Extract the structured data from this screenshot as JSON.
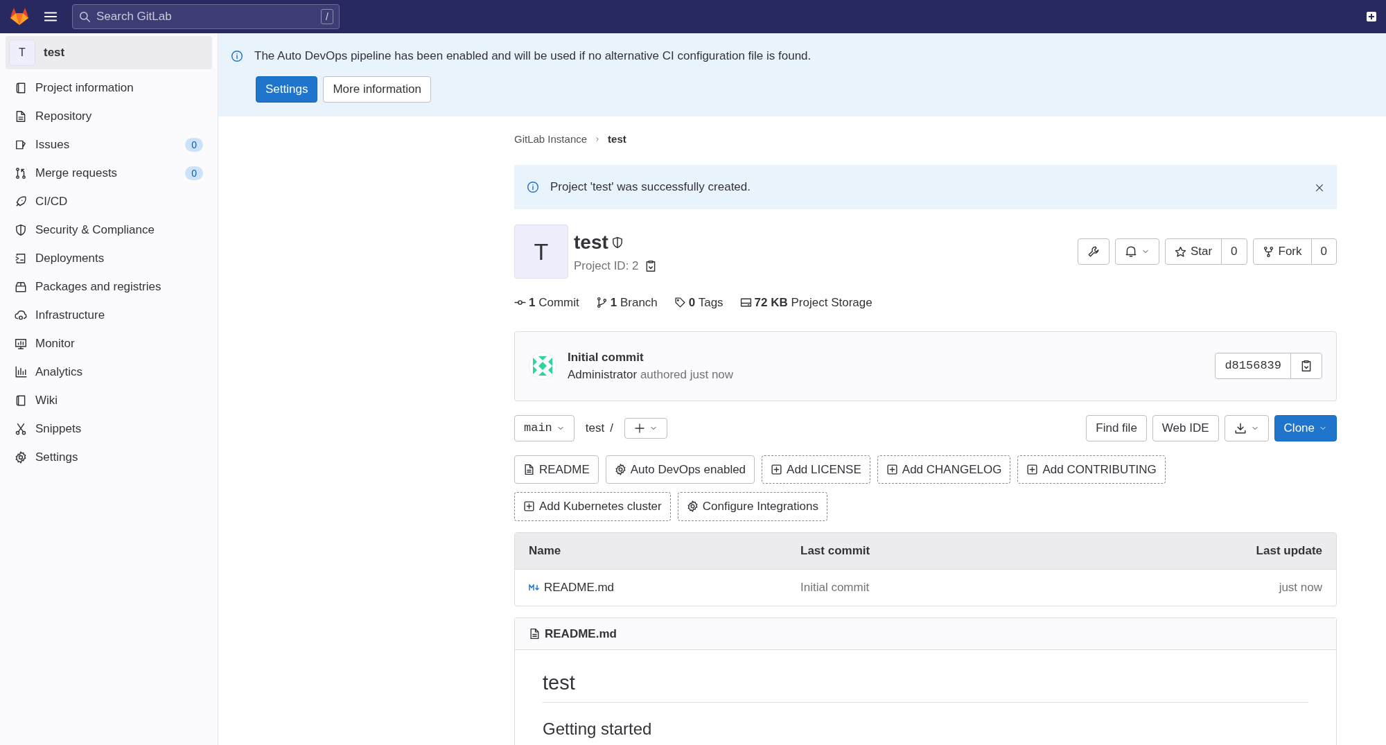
{
  "topbar": {
    "search": {
      "placeholder": "Search GitLab",
      "shortcut": "/"
    }
  },
  "sidebar": {
    "project": {
      "avatar": "T",
      "name": "test",
      "selected": true
    },
    "items": [
      {
        "label": "Project information"
      },
      {
        "label": "Repository"
      },
      {
        "label": "Issues",
        "count": "0"
      },
      {
        "label": "Merge requests",
        "count": "0"
      },
      {
        "label": "CI/CD"
      },
      {
        "label": "Security & Compliance"
      },
      {
        "label": "Deployments"
      },
      {
        "label": "Packages and registries"
      },
      {
        "label": "Infrastructure"
      },
      {
        "label": "Monitor"
      },
      {
        "label": "Analytics"
      },
      {
        "label": "Wiki"
      },
      {
        "label": "Snippets"
      },
      {
        "label": "Settings"
      }
    ]
  },
  "banner": {
    "text": "The Auto DevOps pipeline has been enabled and will be used if no alternative CI configuration file is found.",
    "buttons": [
      {
        "label": "Settings",
        "kind": "primary"
      },
      {
        "label": "More information",
        "kind": "default"
      }
    ]
  },
  "breadcrumb": [
    {
      "label": "GitLab Instance",
      "current": false
    },
    {
      "label": "test",
      "current": true
    }
  ],
  "alert": {
    "text": "Project 'test' was successfully created.",
    "dismissible": true
  },
  "project": {
    "avatar": "T",
    "name": "test",
    "id_label": "Project ID: 2",
    "star": {
      "label": "Star",
      "count": "0"
    },
    "fork": {
      "label": "Fork",
      "count": "0"
    }
  },
  "stats": [
    {
      "value": "1",
      "label": "Commit"
    },
    {
      "value": "1",
      "label": "Branch"
    },
    {
      "value": "0",
      "label": "Tags"
    },
    {
      "value": "72 KB",
      "label": "Project Storage"
    }
  ],
  "commit": {
    "title": "Initial commit",
    "author": "Administrator",
    "meta": "authored just now",
    "sha": "d8156839"
  },
  "toolbar": {
    "branch": "main",
    "path": "test",
    "separator": "/",
    "buttons": [
      {
        "label": "Find file",
        "kind": "default"
      },
      {
        "label": "Web IDE",
        "kind": "default"
      },
      {
        "label": "Clone",
        "kind": "primary"
      }
    ]
  },
  "chips": [
    {
      "label": "README",
      "kind": "existing"
    },
    {
      "label": "Auto DevOps enabled",
      "kind": "existing"
    },
    {
      "label": "Add LICENSE",
      "kind": "add"
    },
    {
      "label": "Add CHANGELOG",
      "kind": "add"
    },
    {
      "label": "Add CONTRIBUTING",
      "kind": "add"
    },
    {
      "label": "Add Kubernetes cluster",
      "kind": "add"
    },
    {
      "label": "Configure Integrations",
      "kind": "add"
    }
  ],
  "table": {
    "columns": [
      "Name",
      "Last commit",
      "Last update"
    ],
    "rows": [
      {
        "name": "README.md",
        "last_commit": "Initial commit",
        "last_update": "just now"
      }
    ]
  },
  "readme": {
    "filename": "README.md",
    "title": "test",
    "subtitle": "Getting started"
  }
}
